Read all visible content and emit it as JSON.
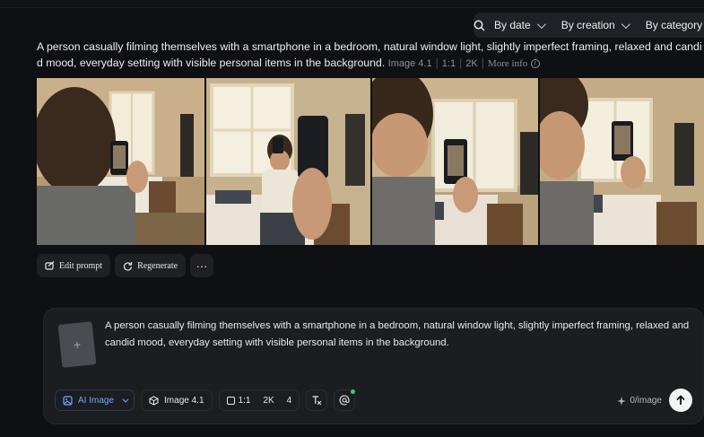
{
  "filters": {
    "search_icon": "search-icon",
    "by_date": "By date",
    "by_creation": "By creation",
    "by_category": "By category"
  },
  "result": {
    "prompt": "A person casually filming themselves with a smartphone in a bedroom, natural window light, slightly imperfect framing, relaxed and candid mood, everyday setting with visible personal items in the background.",
    "model": "Image 4.1",
    "ratio": "1:1",
    "resolution": "2K",
    "more_info": "More info"
  },
  "actions": {
    "edit": "Edit prompt",
    "regenerate": "Regenerate",
    "more": "···"
  },
  "composer": {
    "upload_icon": "+",
    "text": "A person casually filming themselves with a smartphone in a bedroom, natural window light, slightly imperfect framing, relaxed and candid mood, everyday setting with visible personal items in the background.",
    "mode": "AI Image",
    "model": "Image 4.1",
    "ratio": "1:1",
    "resolution": "2K",
    "count": "4",
    "credits": "0/image"
  },
  "colors": {
    "accent": "#6ea8ff",
    "background": "#0f1013",
    "panel": "#1c1d21"
  }
}
